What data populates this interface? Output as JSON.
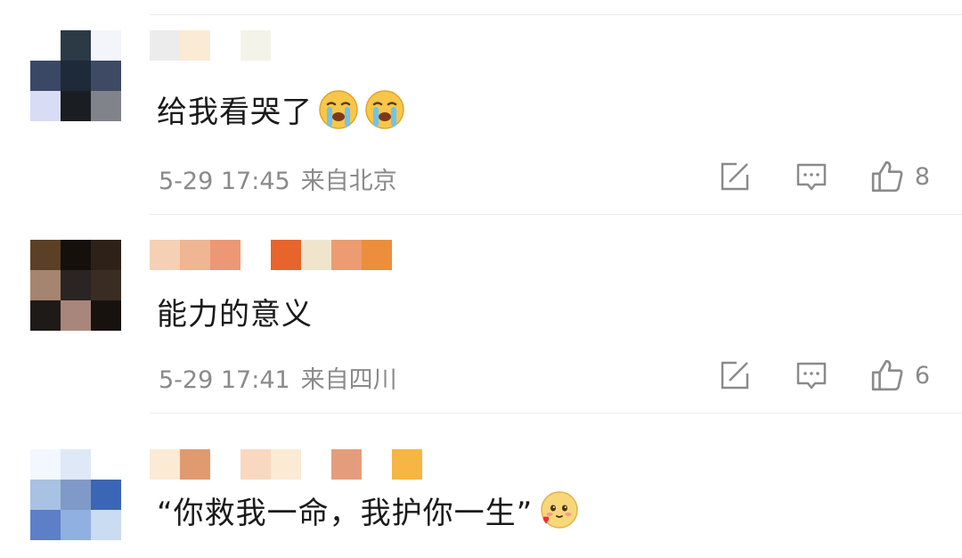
{
  "comments": [
    {
      "text": "给我看哭了",
      "emojis": [
        "crying-emoji",
        "crying-emoji"
      ],
      "time": "5-29 17:45",
      "location": "来自北京",
      "likes": "8",
      "avatar_colors": [
        "#ffffff",
        "#2b3a44",
        "#f4f5fb",
        "#3a4866",
        "#1e2a3a",
        "#3e4a63",
        "#d8dcf5",
        "#1a1e22",
        "#80838a"
      ],
      "username_colors": [
        "#ececec",
        "#fbead4",
        "#ffffff",
        "#f3f3ea"
      ]
    },
    {
      "text": "能力的意义",
      "emojis": [],
      "time": "5-29 17:41",
      "location": "来自四川",
      "likes": "6",
      "avatar_colors": [
        "#5b4026",
        "#15100c",
        "#2e2218",
        "#a58470",
        "#2a2422",
        "#3b2c23",
        "#1e1a18",
        "#a8867c",
        "#18120e"
      ],
      "username_colors": [
        "#f6d0b4",
        "#f0b592",
        "#ec9874",
        "#ffffff",
        "#e7642d",
        "#f0e5cc",
        "#ec9c70",
        "#ec8e3c"
      ]
    },
    {
      "text": "“你救我一命，我护你一生”",
      "emojis": [
        "blushing-heart-emoji"
      ],
      "avatar_colors": [
        "#f3f7ff",
        "#dfe8f6",
        "#ffffff",
        "#a9c1e2",
        "#7f9ac8",
        "#3b66b6",
        "#5c7fc7",
        "#8fb0e0",
        "#c9dcf1"
      ],
      "username_colors": [
        "#fbead4",
        "#e09a70",
        "#ffffff",
        "#f8d8c0",
        "#fbead4",
        "#ffffff",
        "#e59c7c",
        "#ffffff",
        "#f7b544"
      ]
    }
  ],
  "colors": {
    "text": "#1a1a1a",
    "meta": "#8a8a8a",
    "icon": "#8a8a8a",
    "divider": "#ececec"
  },
  "icons": {
    "share": "share-icon",
    "comment": "comment-icon",
    "like": "thumbs-up-icon"
  }
}
